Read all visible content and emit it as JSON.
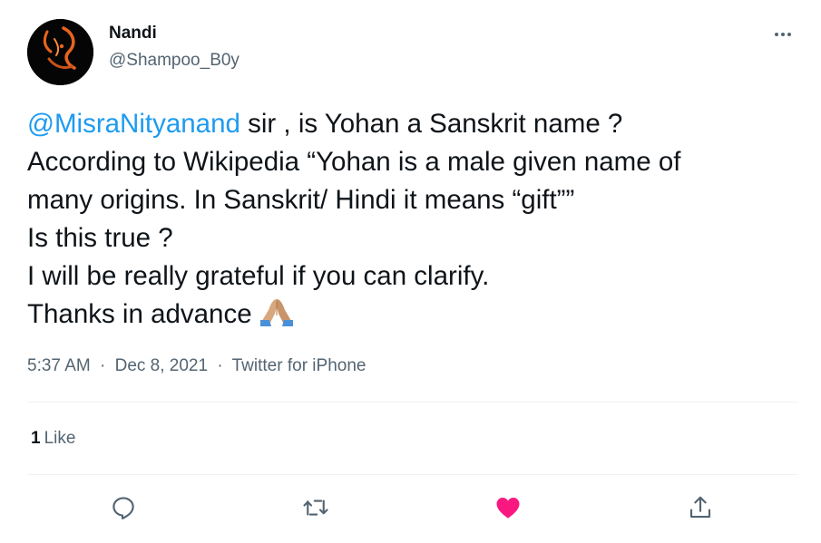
{
  "author": {
    "display_name": "Nandi",
    "handle": "@Shampoo_B0y",
    "avatar_icon": "nandi-avatar"
  },
  "tweet": {
    "mention": "@MisraNityanand",
    "line1_rest": " sir , is Yohan a Sanskrit name ?",
    "line2": "According to Wikipedia “Yohan is a male given name of",
    "line3": "many origins. In Sanskrit/ Hindi it means “gift””",
    "line4": "Is this true ?",
    "line5": "I will be really grateful if you can clarify.",
    "line6": "Thanks in advance",
    "emoji": "folded-hands-icon"
  },
  "meta": {
    "time": "5:37 AM",
    "separator1": "·",
    "date": "Dec 8, 2021",
    "separator2": "·",
    "source": "Twitter for iPhone"
  },
  "stats": {
    "likes_count": "1",
    "likes_label": "Like"
  },
  "actions": {
    "reply_icon": "reply-icon",
    "retweet_icon": "retweet-icon",
    "like_icon": "heart-icon",
    "share_icon": "share-icon"
  },
  "colors": {
    "text": "#0f1419",
    "secondary": "#536471",
    "link": "#1d9bf0",
    "like": "#f91880",
    "divider": "#eff3f4",
    "avatar_bg": "#050505",
    "avatar_accent": "#e8641e"
  }
}
